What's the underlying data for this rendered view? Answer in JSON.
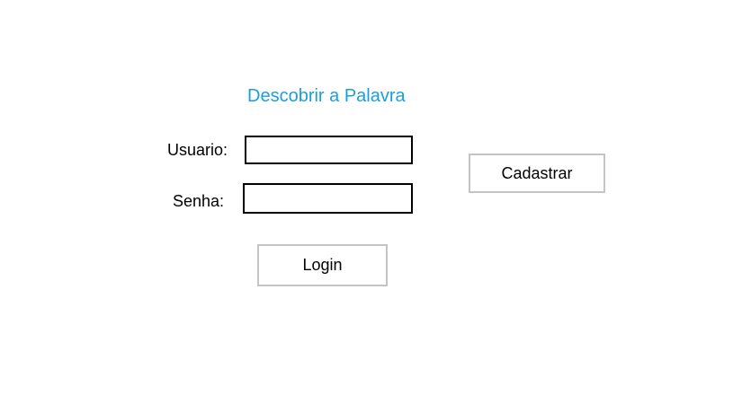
{
  "app": {
    "title": "Descobrir a Palavra"
  },
  "login_form": {
    "user_label": "Usuario:",
    "user_value": "",
    "password_label": "Senha:",
    "password_value": "",
    "login_button": "Login"
  },
  "register": {
    "button_label": "Cadastrar"
  },
  "colors": {
    "title": "#1a9fd9",
    "field_border": "#000000",
    "button_border": "#c4c4c4",
    "background": "#ffffff"
  }
}
